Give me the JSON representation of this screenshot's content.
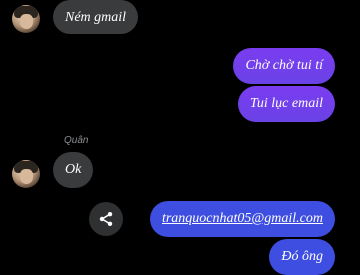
{
  "messages": [
    {
      "id": "m1",
      "direction": "incoming",
      "text": "Ném gmail"
    },
    {
      "id": "m2",
      "direction": "outgoing",
      "text": "Chờ chờ tui tí"
    },
    {
      "id": "m3",
      "direction": "outgoing",
      "text": "Tui lục email"
    },
    {
      "id": "m4",
      "direction": "incoming",
      "sender": "Quân",
      "text": "Ok"
    },
    {
      "id": "m5",
      "direction": "outgoing",
      "text": "tranquocnhat05@gmail.com",
      "is_link": true
    },
    {
      "id": "m6",
      "direction": "outgoing",
      "text": "Đó ông"
    }
  ],
  "icons": {
    "share": "share-icon",
    "avatar": "avatar"
  },
  "colors": {
    "background": "#000000",
    "incoming_bubble": "#3a3b3c",
    "outgoing_bubble": "#6a42e6",
    "link_bubble": "#3d4ee0",
    "sender_name": "#8a8d91"
  }
}
